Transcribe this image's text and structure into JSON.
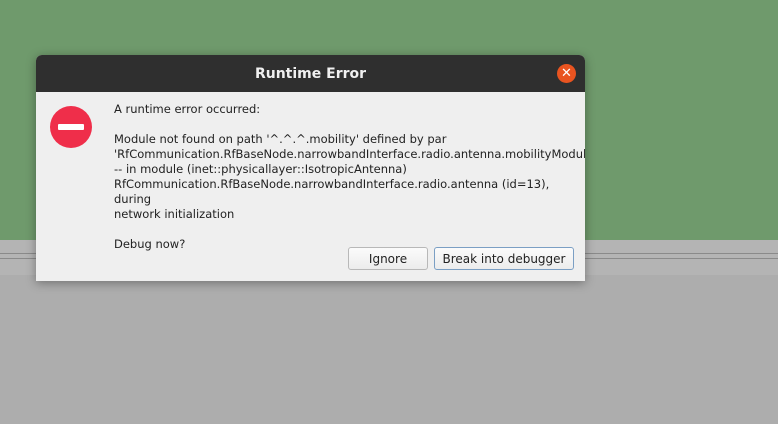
{
  "dialog": {
    "title": "Runtime Error",
    "close_icon": "close-icon",
    "status_icon": "error-stop-icon",
    "colors": {
      "titlebar": "#2f2f2f",
      "close": "#e95420",
      "error_icon": "#ef2e4a",
      "background_top": "#6f9a6c"
    },
    "heading": "A runtime error occurred:",
    "message": "Module not found on path '^.^.^.mobility' defined by par\n'RfCommunication.RfBaseNode.narrowbandInterface.radio.antenna.mobilityModule'\n-- in module (inet::physicallayer::IsotropicAntenna)\nRfCommunication.RfBaseNode.narrowbandInterface.radio.antenna (id=13), during\nnetwork initialization",
    "question": "Debug now?",
    "buttons": {
      "ignore": "Ignore",
      "break": "Break into debugger"
    }
  }
}
